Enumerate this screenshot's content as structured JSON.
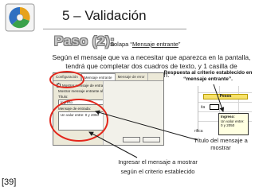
{
  "slide": {
    "title": "5 – Validación",
    "step_heading": "Paso (2):",
    "tab_prefix": "Solapa “",
    "tab_name": "Mensaje entrante",
    "tab_suffix": "”",
    "description": "Según el mensaje que va a necesitar que aparezca en la pantalla, tendrá que completar dos cuadros de texto, y 1 casilla de verificación.",
    "page_number": "[39]"
  },
  "dialog": {
    "tabs": [
      "Configuración",
      "Mensaje entrante",
      "Mensaje de error"
    ],
    "checkbox_label": "Mostrar mensaje de entrada al seleccionar la celda",
    "section_label": "Mostrar mensaje entrante al seleccionar la celda:",
    "title_label": "Título:",
    "title_value": "Ingreso",
    "message_label": "Mensaje de entrada:",
    "message_value": "Un valor entre: 0 y 2050"
  },
  "annotations": {
    "criteria_label": "Respuesta al criterio establecido en “mensaje entrante”.",
    "title_note": "Título del mensaje a mostrar",
    "bottom_note": "Ingresar el mensaje a mostrar según el criterio establecido"
  },
  "spreadsheet": {
    "header_text": "Pesos",
    "cell_a": "ita",
    "cell_b": "rifica",
    "tooltip_title": "Ingreso:",
    "tooltip_text": "Un valor entre: 0 y 2050"
  },
  "colors": {
    "highlight_ellipse": "#e3261b",
    "arrow": "#1a1a1a"
  },
  "icons": {
    "logo": "pie-chart-icon"
  }
}
